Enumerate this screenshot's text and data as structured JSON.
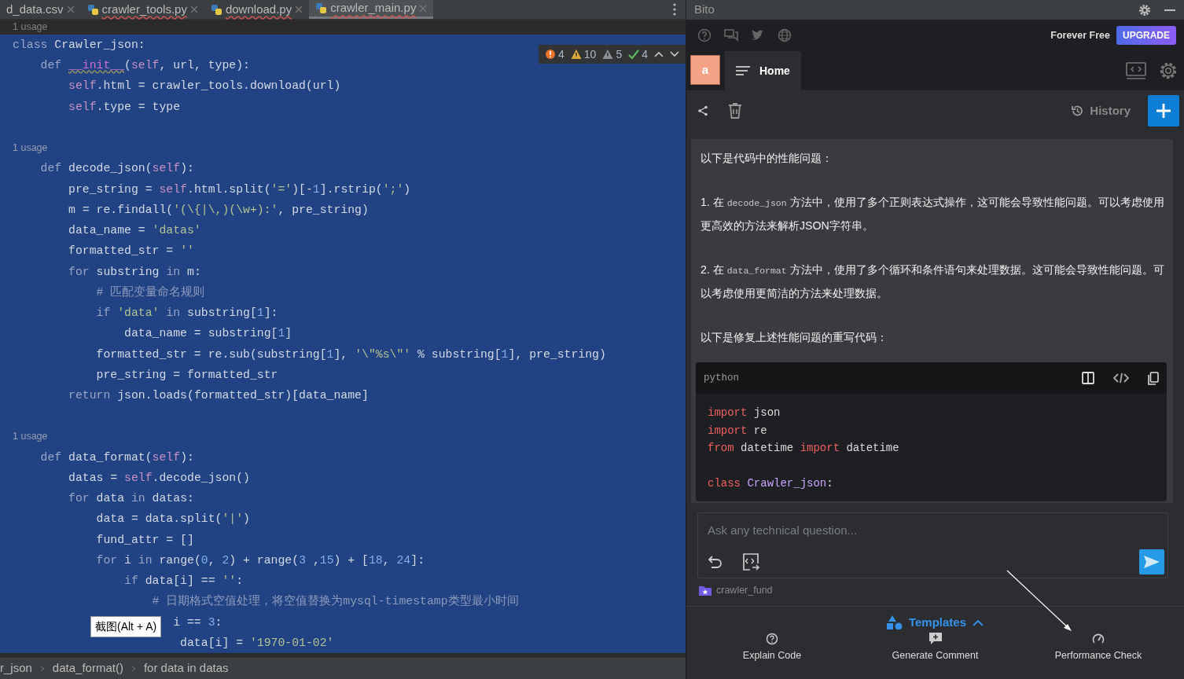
{
  "editor": {
    "tabs": [
      {
        "label": "d_data.csv",
        "kind": "csv",
        "selected": false
      },
      {
        "label": "crawler_tools.py",
        "kind": "python",
        "selected": false
      },
      {
        "label": "download.py",
        "kind": "python",
        "selected": false
      },
      {
        "label": "crawler_main.py",
        "kind": "python",
        "selected": true
      }
    ],
    "inspections": [
      {
        "kind": "error",
        "count": "4"
      },
      {
        "kind": "warning",
        "count": "10"
      },
      {
        "kind": "weak",
        "count": "5"
      },
      {
        "kind": "ok",
        "count": "4"
      }
    ],
    "lines": [
      {
        "kind": "hint",
        "selected": false,
        "text": "1 usage"
      },
      {
        "kind": "code",
        "selected": true,
        "parts": [
          {
            "kind": "kw",
            "text": "class"
          },
          {
            "kind": "p",
            "text": " Crawler_json:"
          }
        ]
      },
      {
        "kind": "code",
        "selected": true,
        "parts": [
          {
            "kind": "kw",
            "text": "    def "
          },
          {
            "kind": "fn",
            "text": "__init__"
          },
          {
            "kind": "p",
            "text": "("
          },
          {
            "kind": "self",
            "text": "self"
          },
          {
            "kind": "p",
            "text": ", url, type):"
          }
        ]
      },
      {
        "kind": "code",
        "selected": true,
        "parts": [
          {
            "kind": "self",
            "text": "        self"
          },
          {
            "kind": "p",
            "text": ".html = crawler_tools.download(url)"
          }
        ]
      },
      {
        "kind": "code",
        "selected": true,
        "parts": [
          {
            "kind": "self",
            "text": "        self"
          },
          {
            "kind": "p",
            "text": ".type = type"
          }
        ]
      },
      {
        "kind": "blank",
        "selected": true
      },
      {
        "kind": "hint",
        "selected": true,
        "text": "    1 usage"
      },
      {
        "kind": "code",
        "selected": true,
        "parts": [
          {
            "kind": "kw",
            "text": "    def"
          },
          {
            "kind": "p",
            "text": " decode_json("
          },
          {
            "kind": "self",
            "text": "self"
          },
          {
            "kind": "p",
            "text": "):"
          }
        ]
      },
      {
        "kind": "code",
        "selected": true,
        "parts": [
          {
            "kind": "p",
            "text": "        pre_string = "
          },
          {
            "kind": "self",
            "text": "self"
          },
          {
            "kind": "p",
            "text": ".html.split("
          },
          {
            "kind": "str",
            "text": "'='"
          },
          {
            "kind": "p",
            "text": ")[-"
          },
          {
            "kind": "num",
            "text": "1"
          },
          {
            "kind": "p",
            "text": "].rstrip("
          },
          {
            "kind": "str",
            "text": "';'"
          },
          {
            "kind": "p",
            "text": ")"
          }
        ]
      },
      {
        "kind": "code",
        "selected": true,
        "parts": [
          {
            "kind": "p",
            "text": "        m = re.findall("
          },
          {
            "kind": "str",
            "text": "'(\\{|\\,)(\\w+):'"
          },
          {
            "kind": "p",
            "text": ", pre_string)"
          }
        ]
      },
      {
        "kind": "code",
        "selected": true,
        "parts": [
          {
            "kind": "p",
            "text": "        data_name = "
          },
          {
            "kind": "str",
            "text": "'datas'"
          }
        ]
      },
      {
        "kind": "code",
        "selected": true,
        "parts": [
          {
            "kind": "p",
            "text": "        formatted_str = "
          },
          {
            "kind": "str",
            "text": "''"
          }
        ]
      },
      {
        "kind": "code",
        "selected": true,
        "parts": [
          {
            "kind": "kw",
            "text": "        for"
          },
          {
            "kind": "p",
            "text": " substring "
          },
          {
            "kind": "kw",
            "text": "in"
          },
          {
            "kind": "p",
            "text": " m:"
          }
        ]
      },
      {
        "kind": "code",
        "selected": true,
        "parts": [
          {
            "kind": "cmt",
            "text": "            # 匹配变量命名规则"
          }
        ]
      },
      {
        "kind": "code",
        "selected": true,
        "parts": [
          {
            "kind": "kw",
            "text": "            if "
          },
          {
            "kind": "str",
            "text": "'data'"
          },
          {
            "kind": "kw",
            "text": " in"
          },
          {
            "kind": "p",
            "text": " substring["
          },
          {
            "kind": "num",
            "text": "1"
          },
          {
            "kind": "p",
            "text": "]:"
          }
        ]
      },
      {
        "kind": "code",
        "selected": true,
        "parts": [
          {
            "kind": "p",
            "text": "                data_name = substring["
          },
          {
            "kind": "num",
            "text": "1"
          },
          {
            "kind": "p",
            "text": "]"
          }
        ]
      },
      {
        "kind": "code",
        "selected": true,
        "parts": [
          {
            "kind": "p",
            "text": "            formatted_str = re.sub(substring["
          },
          {
            "kind": "num",
            "text": "1"
          },
          {
            "kind": "p",
            "text": "], "
          },
          {
            "kind": "str",
            "text": "'\\\"%s\\\"'"
          },
          {
            "kind": "p",
            "text": " % substring["
          },
          {
            "kind": "num",
            "text": "1"
          },
          {
            "kind": "p",
            "text": "], pre_string)"
          }
        ]
      },
      {
        "kind": "code",
        "selected": true,
        "parts": [
          {
            "kind": "p",
            "text": "            pre_string = formatted_str"
          }
        ]
      },
      {
        "kind": "code",
        "selected": true,
        "parts": [
          {
            "kind": "kw",
            "text": "        return"
          },
          {
            "kind": "p",
            "text": " json.loads(formatted_str)[data_name]"
          }
        ]
      },
      {
        "kind": "blank",
        "selected": true
      },
      {
        "kind": "hint",
        "selected": true,
        "text": "    1 usage"
      },
      {
        "kind": "code",
        "selected": true,
        "parts": [
          {
            "kind": "kw",
            "text": "    def"
          },
          {
            "kind": "p",
            "text": " data_format("
          },
          {
            "kind": "self",
            "text": "self"
          },
          {
            "kind": "p",
            "text": "):"
          }
        ]
      },
      {
        "kind": "code",
        "selected": true,
        "parts": [
          {
            "kind": "p",
            "text": "        datas = "
          },
          {
            "kind": "self",
            "text": "self"
          },
          {
            "kind": "p",
            "text": ".decode_json()"
          }
        ]
      },
      {
        "kind": "code",
        "selected": true,
        "parts": [
          {
            "kind": "kw",
            "text": "        for"
          },
          {
            "kind": "p",
            "text": " data "
          },
          {
            "kind": "kw",
            "text": "in"
          },
          {
            "kind": "p",
            "text": " datas:"
          }
        ]
      },
      {
        "kind": "code",
        "selected": true,
        "parts": [
          {
            "kind": "p",
            "text": "            data = data.split("
          },
          {
            "kind": "str",
            "text": "'|'"
          },
          {
            "kind": "p",
            "text": ")"
          }
        ]
      },
      {
        "kind": "code",
        "selected": true,
        "parts": [
          {
            "kind": "p",
            "text": "            fund_attr = []"
          }
        ]
      },
      {
        "kind": "code",
        "selected": true,
        "parts": [
          {
            "kind": "kw",
            "text": "            for"
          },
          {
            "kind": "p",
            "text": " i "
          },
          {
            "kind": "kw",
            "text": "in"
          },
          {
            "kind": "p",
            "text": " range("
          },
          {
            "kind": "num",
            "text": "0"
          },
          {
            "kind": "p",
            "text": ", "
          },
          {
            "kind": "num",
            "text": "2"
          },
          {
            "kind": "p",
            "text": ") + range("
          },
          {
            "kind": "num",
            "text": "3"
          },
          {
            "kind": "p",
            "text": " ,"
          },
          {
            "kind": "num",
            "text": "15"
          },
          {
            "kind": "p",
            "text": ") + ["
          },
          {
            "kind": "num",
            "text": "18"
          },
          {
            "kind": "p",
            "text": ", "
          },
          {
            "kind": "num",
            "text": "24"
          },
          {
            "kind": "p",
            "text": "]:"
          }
        ]
      },
      {
        "kind": "code",
        "selected": true,
        "parts": [
          {
            "kind": "kw",
            "text": "                if"
          },
          {
            "kind": "p",
            "text": " data[i] == "
          },
          {
            "kind": "str",
            "text": "''"
          },
          {
            "kind": "p",
            "text": ":"
          }
        ]
      },
      {
        "kind": "code",
        "selected": true,
        "parts": [
          {
            "kind": "cmt",
            "text": "                    # 日期格式空值处理，将空值替换为mysql-timestamp类型最小时间"
          }
        ]
      },
      {
        "kind": "code",
        "selected": true,
        "parts": [
          {
            "kind": "p",
            "text": "                       i == "
          },
          {
            "kind": "num",
            "text": "3"
          },
          {
            "kind": "p",
            "text": ":"
          }
        ]
      },
      {
        "kind": "code",
        "selected": true,
        "parts": [
          {
            "kind": "p",
            "text": "                        data[i] = "
          },
          {
            "kind": "str",
            "text": "'1970-01-02'"
          }
        ]
      }
    ],
    "tooltip": "截图(Alt + A)",
    "breadcrumbs": [
      "r_json",
      "data_format()",
      "for data in datas"
    ]
  },
  "bito": {
    "title": "Bito",
    "plan": "Forever Free",
    "upgrade": "UPGRADE",
    "avatar": "a",
    "home_tab": "Home",
    "history": "History",
    "messages": [
      {
        "parts": [
          {
            "kind": "text",
            "text": "以下是代码中的性能问题："
          }
        ]
      },
      {
        "parts": [
          {
            "kind": "text",
            "text": "1. 在 "
          },
          {
            "kind": "code",
            "text": "decode_json"
          },
          {
            "kind": "text",
            "text": " 方法中，使用了多个正则表达式操作，这可能会导致性能问题。可以考虑使用更高效的方法来解析JSON字符串。"
          }
        ]
      },
      {
        "parts": [
          {
            "kind": "text",
            "text": "2. 在 "
          },
          {
            "kind": "code",
            "text": "data_format"
          },
          {
            "kind": "text",
            "text": " 方法中，使用了多个循环和条件语句来处理数据。这可能会导致性能问题。可以考虑使用更简洁的方法来处理数据。"
          }
        ]
      },
      {
        "parts": [
          {
            "kind": "text",
            "text": "以下是修复上述性能问题的重写代码："
          }
        ]
      }
    ],
    "code_block": {
      "language": "python",
      "lines": [
        {
          "kind": "code",
          "parts": [
            {
              "kind": "kw",
              "text": "import"
            },
            {
              "kind": "p",
              "text": " json"
            }
          ]
        },
        {
          "kind": "code",
          "parts": [
            {
              "kind": "kw",
              "text": "import"
            },
            {
              "kind": "p",
              "text": " re"
            }
          ]
        },
        {
          "kind": "code",
          "parts": [
            {
              "kind": "kw",
              "text": "from"
            },
            {
              "kind": "p",
              "text": " datetime "
            },
            {
              "kind": "kw",
              "text": "import"
            },
            {
              "kind": "p",
              "text": " datetime"
            }
          ]
        },
        {
          "kind": "blank"
        },
        {
          "kind": "code",
          "parts": [
            {
              "kind": "kw",
              "text": "class "
            },
            {
              "kind": "cls",
              "text": "Crawler_json"
            },
            {
              "kind": "p",
              "text": ":"
            }
          ]
        }
      ]
    },
    "input": {
      "placeholder": "Ask any technical question..."
    },
    "context": "crawler_fund",
    "templates": {
      "label": "Templates",
      "expanded": true,
      "items": [
        {
          "kind": "explain",
          "label": "Explain Code"
        },
        {
          "kind": "comment",
          "label": "Generate Comment"
        },
        {
          "kind": "performance",
          "label": "Performance Check"
        }
      ]
    }
  }
}
